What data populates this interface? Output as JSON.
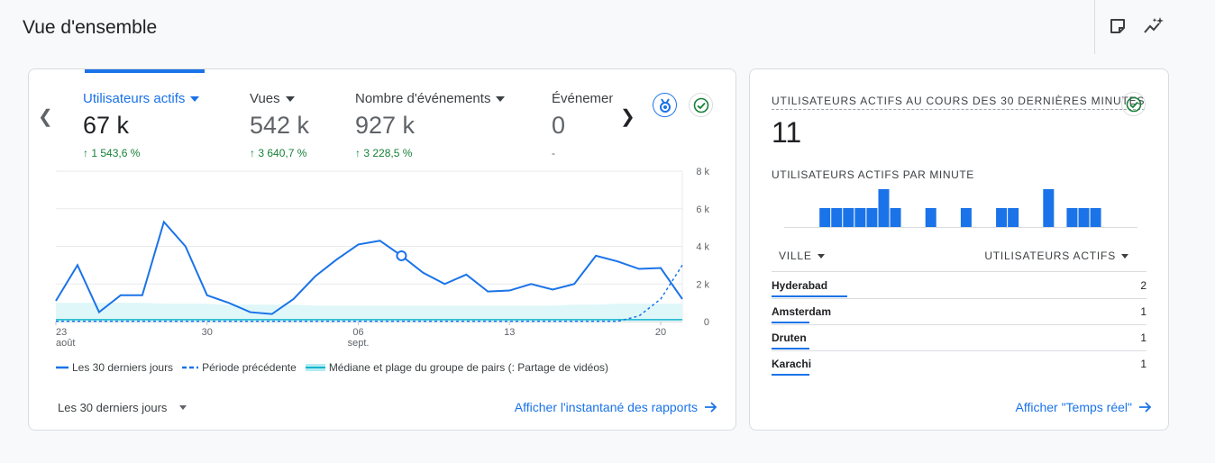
{
  "page": {
    "title": "Vue d'ensemble"
  },
  "icons": {
    "note": "note-icon",
    "insights": "insights-sparkle-icon"
  },
  "metrics": [
    {
      "label": "Utilisateurs actifs",
      "value": "67 k",
      "change": "↑ 1 543,6 %",
      "active": true
    },
    {
      "label": "Vues",
      "value": "542 k",
      "change": "↑ 3 640,7 %"
    },
    {
      "label": "Nombre d'événements",
      "value": "927 k",
      "change": "↑ 3 228,5 %"
    },
    {
      "label": "Événements clés",
      "value": "0",
      "change": "-"
    }
  ],
  "chart_data": {
    "type": "line",
    "x_tick_labels": [
      {
        "label": "23",
        "sub": "août"
      },
      {
        "label": "30",
        "sub": ""
      },
      {
        "label": "06",
        "sub": "sept."
      },
      {
        "label": "13",
        "sub": ""
      },
      {
        "label": "20",
        "sub": ""
      }
    ],
    "y_tick_labels": [
      "8 k",
      "6 k",
      "4 k",
      "2 k",
      "0"
    ],
    "ylim": [
      0,
      8000
    ],
    "x_days": 30,
    "series": [
      {
        "name": "Les 30 derniers jours",
        "style": "solid",
        "color": "#1a73e8",
        "values": [
          1100,
          3000,
          500,
          1400,
          1400,
          5300,
          4000,
          1400,
          1000,
          500,
          400,
          1200,
          2400,
          3300,
          4100,
          4300,
          3500,
          2600,
          2000,
          2500,
          1600,
          1650,
          2000,
          1700,
          2000,
          3500,
          3200,
          2800,
          2850,
          1200
        ]
      },
      {
        "name": "Période précédente",
        "style": "dashed",
        "color": "#1a73e8",
        "values": [
          10,
          10,
          10,
          10,
          10,
          10,
          10,
          10,
          10,
          10,
          10,
          10,
          10,
          10,
          10,
          10,
          10,
          10,
          10,
          10,
          10,
          10,
          10,
          10,
          10,
          10,
          10,
          300,
          1200,
          3000
        ]
      },
      {
        "name": "Médiane et plage du groupe de pairs (: Partage de vidéos)",
        "style": "band",
        "color": "#12b5cb",
        "median": [
          100,
          100,
          100,
          100,
          100,
          100,
          100,
          100,
          100,
          100,
          100,
          100,
          100,
          100,
          100,
          100,
          100,
          100,
          100,
          100,
          100,
          100,
          100,
          100,
          100,
          100,
          100,
          100,
          100,
          100
        ],
        "upper": [
          1000,
          1000,
          1000,
          1000,
          1000,
          950,
          950,
          950,
          900,
          900,
          900,
          900,
          850,
          850,
          850,
          850,
          850,
          850,
          850,
          850,
          850,
          850,
          850,
          850,
          900,
          900,
          950,
          950,
          950,
          950
        ]
      }
    ],
    "highlight_point_index": 16
  },
  "legend": {
    "current": "Les 30 derniers jours",
    "previous": "Période précédente",
    "peers": "Médiane et plage du groupe de pairs (: Partage de vidéos)"
  },
  "footer": {
    "date_range": "Les 30 derniers jours",
    "report_link": "Afficher l'instantané des rapports"
  },
  "realtime": {
    "title": "UTILISATEURS ACTIFS AU COURS DES 30 DERNIÈRES MINUTES",
    "value": "11",
    "per_minute_label": "UTILISATEURS ACTIFS PAR MINUTE",
    "per_minute": [
      0,
      0,
      0,
      1,
      1,
      1,
      1,
      1,
      2,
      1,
      0,
      0,
      1,
      0,
      0,
      1,
      0,
      0,
      1,
      1,
      0,
      0,
      2,
      0,
      1,
      1,
      1,
      0,
      0,
      0
    ],
    "col_city": "VILLE",
    "col_users": "UTILISATEURS ACTIFS",
    "rows": [
      {
        "city": "Hyderabad",
        "users": "2",
        "share": 1.0
      },
      {
        "city": "Amsterdam",
        "users": "1",
        "share": 0.5
      },
      {
        "city": "Druten",
        "users": "1",
        "share": 0.5
      },
      {
        "city": "Karachi",
        "users": "1",
        "share": 0.5
      }
    ],
    "link": "Afficher \"Temps réel\""
  },
  "colors": {
    "accent": "#1a73e8",
    "positive": "#188038",
    "peer_band": "#e0f7fa"
  }
}
